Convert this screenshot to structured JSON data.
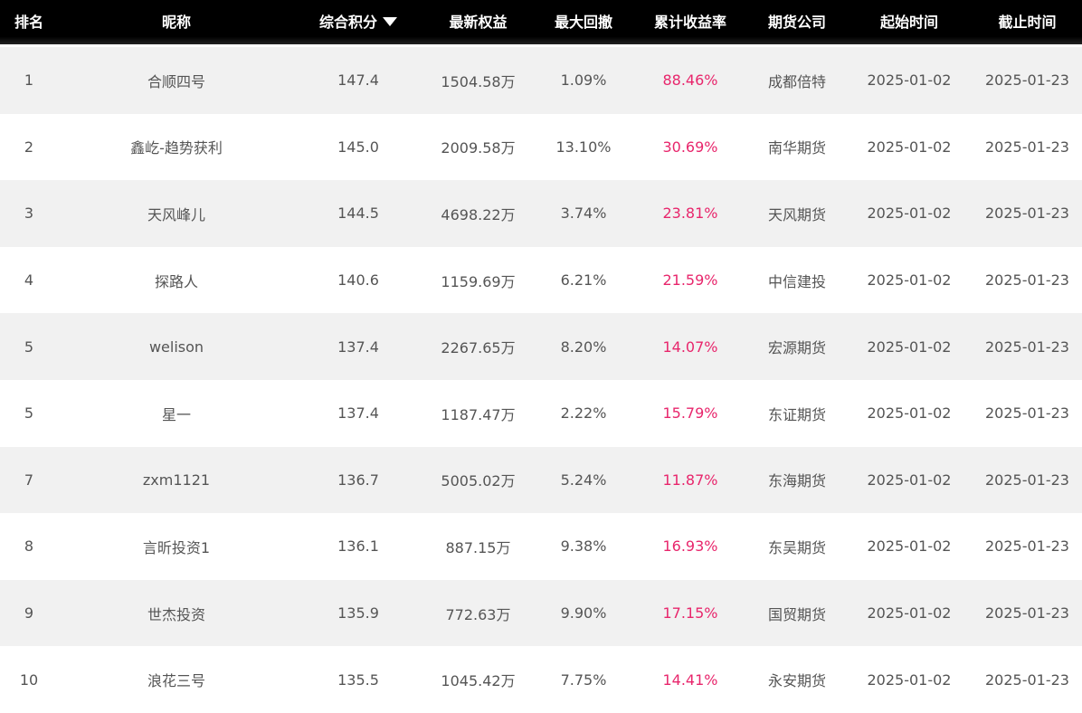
{
  "columns": {
    "rank": "排名",
    "nickname": "昵称",
    "score": "综合积分",
    "equity": "最新权益",
    "drawdown": "最大回撤",
    "return": "累计收益率",
    "broker": "期货公司",
    "start": "起始时间",
    "end": "截止时间"
  },
  "sort": {
    "column": "score",
    "direction": "desc",
    "icon": "caret-down-icon"
  },
  "colors": {
    "header_bg": "#000000",
    "return_text": "#e8266c",
    "odd_row": "#f1f1f1",
    "even_row": "#ffffff"
  },
  "rows": [
    {
      "rank": "1",
      "nickname": "合顺四号",
      "score": "147.4",
      "equity": "1504.58万",
      "drawdown": "1.09%",
      "return": "88.46%",
      "broker": "成都倍特",
      "start": "2025-01-02",
      "end": "2025-01-23"
    },
    {
      "rank": "2",
      "nickname": "鑫屹-趋势获利",
      "score": "145.0",
      "equity": "2009.58万",
      "drawdown": "13.10%",
      "return": "30.69%",
      "broker": "南华期货",
      "start": "2025-01-02",
      "end": "2025-01-23"
    },
    {
      "rank": "3",
      "nickname": "天风峰儿",
      "score": "144.5",
      "equity": "4698.22万",
      "drawdown": "3.74%",
      "return": "23.81%",
      "broker": "天风期货",
      "start": "2025-01-02",
      "end": "2025-01-23"
    },
    {
      "rank": "4",
      "nickname": "探路人",
      "score": "140.6",
      "equity": "1159.69万",
      "drawdown": "6.21%",
      "return": "21.59%",
      "broker": "中信建投",
      "start": "2025-01-02",
      "end": "2025-01-23"
    },
    {
      "rank": "5",
      "nickname": "welison",
      "score": "137.4",
      "equity": "2267.65万",
      "drawdown": "8.20%",
      "return": "14.07%",
      "broker": "宏源期货",
      "start": "2025-01-02",
      "end": "2025-01-23"
    },
    {
      "rank": "5",
      "nickname": "星一",
      "score": "137.4",
      "equity": "1187.47万",
      "drawdown": "2.22%",
      "return": "15.79%",
      "broker": "东证期货",
      "start": "2025-01-02",
      "end": "2025-01-23"
    },
    {
      "rank": "7",
      "nickname": "zxm1121",
      "score": "136.7",
      "equity": "5005.02万",
      "drawdown": "5.24%",
      "return": "11.87%",
      "broker": "东海期货",
      "start": "2025-01-02",
      "end": "2025-01-23"
    },
    {
      "rank": "8",
      "nickname": "言昕投资1",
      "score": "136.1",
      "equity": "887.15万",
      "drawdown": "9.38%",
      "return": "16.93%",
      "broker": "东吴期货",
      "start": "2025-01-02",
      "end": "2025-01-23"
    },
    {
      "rank": "9",
      "nickname": "世杰投资",
      "score": "135.9",
      "equity": "772.63万",
      "drawdown": "9.90%",
      "return": "17.15%",
      "broker": "国贸期货",
      "start": "2025-01-02",
      "end": "2025-01-23"
    },
    {
      "rank": "10",
      "nickname": "浪花三号",
      "score": "135.5",
      "equity": "1045.42万",
      "drawdown": "7.75%",
      "return": "14.41%",
      "broker": "永安期货",
      "start": "2025-01-02",
      "end": "2025-01-23"
    }
  ]
}
